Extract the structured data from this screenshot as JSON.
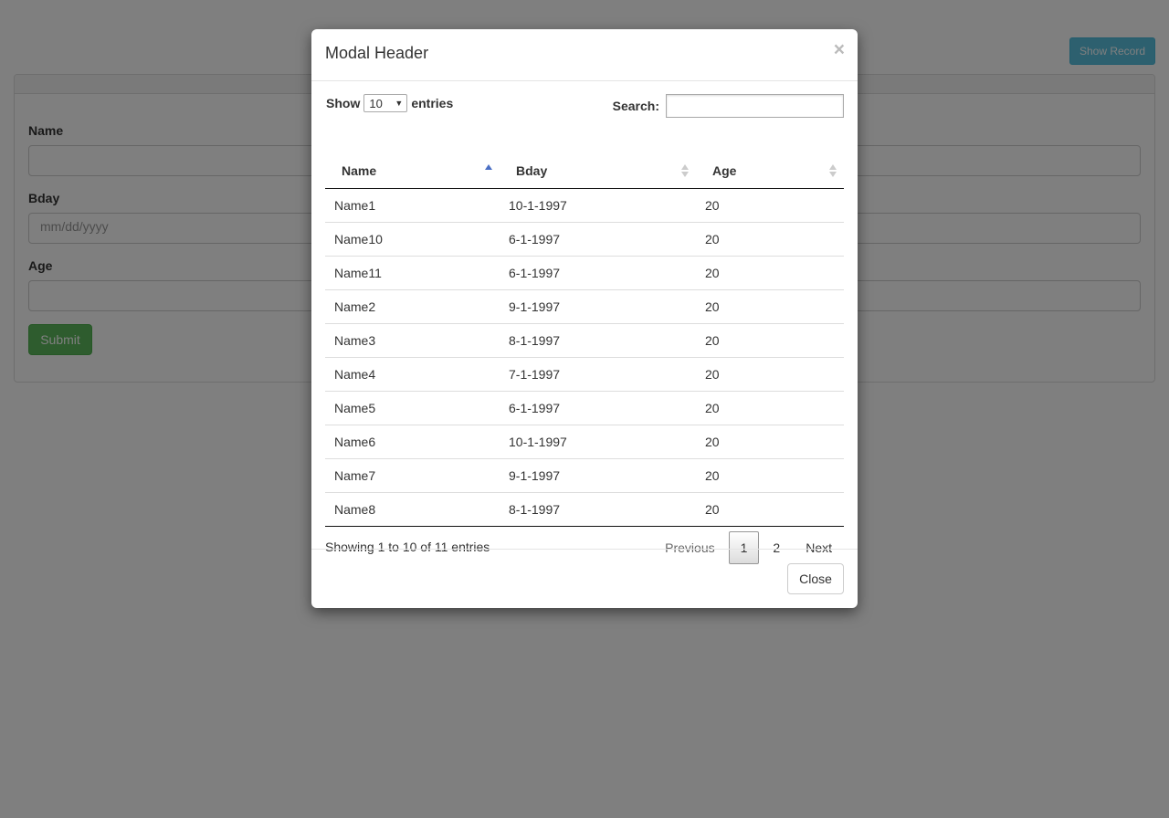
{
  "header": {
    "show_record_label": "Show Record"
  },
  "form": {
    "name_label": "Name",
    "bday_label": "Bday",
    "bday_placeholder": "mm/dd/yyyy",
    "age_label": "Age",
    "submit_label": "Submit"
  },
  "modal": {
    "title": "Modal Header",
    "close_x": "×",
    "length": {
      "prefix": "Show",
      "value": "10",
      "suffix": "entries"
    },
    "search_label": "Search:",
    "columns": [
      "Name",
      "Bday",
      "Age"
    ],
    "sorted_column": "Name",
    "rows": [
      [
        "Name1",
        "10-1-1997",
        "20"
      ],
      [
        "Name10",
        "6-1-1997",
        "20"
      ],
      [
        "Name11",
        "6-1-1997",
        "20"
      ],
      [
        "Name2",
        "9-1-1997",
        "20"
      ],
      [
        "Name3",
        "8-1-1997",
        "20"
      ],
      [
        "Name4",
        "7-1-1997",
        "20"
      ],
      [
        "Name5",
        "6-1-1997",
        "20"
      ],
      [
        "Name6",
        "10-1-1997",
        "20"
      ],
      [
        "Name7",
        "9-1-1997",
        "20"
      ],
      [
        "Name8",
        "8-1-1997",
        "20"
      ]
    ],
    "info": "Showing 1 to 10 of 11 entries",
    "pagination": {
      "previous": "Previous",
      "pages": [
        "1",
        "2"
      ],
      "current": "1",
      "next": "Next"
    },
    "footer_close_label": "Close"
  },
  "colors": {
    "info_button": "#5bc0de",
    "success_button": "#5cb85c",
    "sort_active": "#4a6fc4"
  }
}
